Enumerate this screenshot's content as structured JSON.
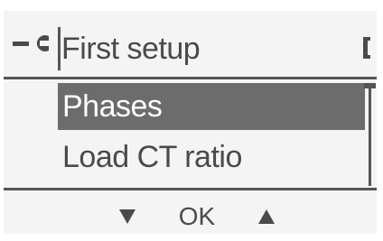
{
  "header": {
    "title": "First setup",
    "left_icon": "wrench-icon",
    "right_icon": "battery-icon"
  },
  "menu": {
    "items": [
      {
        "label": "Phases",
        "selected": true
      },
      {
        "label": "Load CT ratio",
        "selected": false
      }
    ]
  },
  "footer": {
    "down_icon": "arrow-down-icon",
    "ok_label": "OK",
    "up_icon": "arrow-up-icon"
  },
  "colors": {
    "background": "#f4f4f4",
    "text": "#4a4a4a",
    "selection_bg": "#6c6c6c",
    "selection_text": "#ffffff",
    "rule": "#555555"
  }
}
